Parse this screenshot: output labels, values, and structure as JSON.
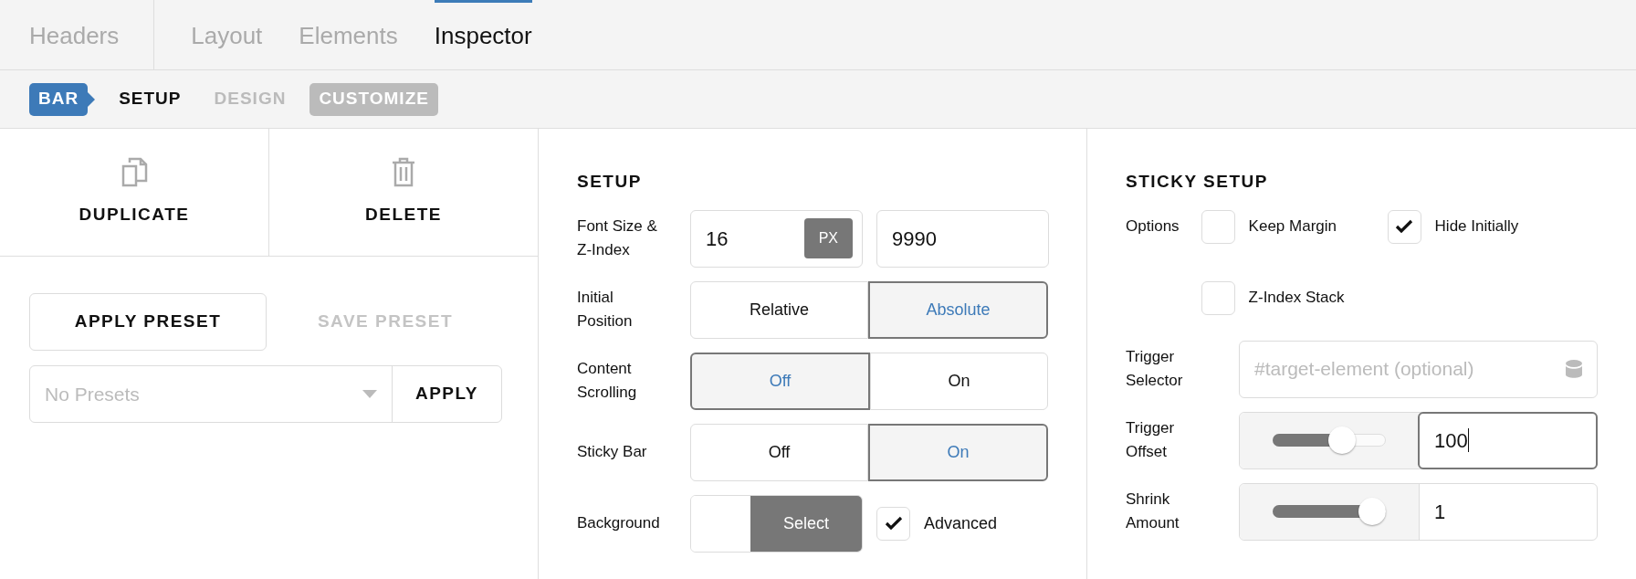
{
  "tabs": [
    {
      "label": "Headers",
      "selected": false
    },
    {
      "label": "Layout",
      "selected": false
    },
    {
      "label": "Elements",
      "selected": false
    },
    {
      "label": "Inspector",
      "selected": true
    }
  ],
  "breadcrumb": {
    "badge": "BAR",
    "steps": [
      {
        "label": "SETUP",
        "selected": true,
        "highlighted": false
      },
      {
        "label": "DESIGN",
        "selected": false,
        "highlighted": false
      },
      {
        "label": "CUSTOMIZE",
        "selected": false,
        "highlighted": true
      }
    ]
  },
  "actions": [
    {
      "label": "DUPLICATE",
      "kind": "copy"
    },
    {
      "label": "DELETE",
      "kind": "trash"
    }
  ],
  "presets": {
    "apply_preset": "APPLY PRESET",
    "save_preset": "SAVE PRESET",
    "save_disabled": true,
    "select_placeholder": "No Presets",
    "apply": "APPLY"
  },
  "setup": {
    "title": "SETUP",
    "rows": [
      {
        "kind": "inputs",
        "label": "Font Size & Z-Index",
        "value": "16",
        "unit": "PX",
        "value_2": "9990"
      },
      {
        "kind": "segmented",
        "label": "Initial Position",
        "options": [
          {
            "label": "Relative",
            "selected": false
          },
          {
            "label": "Absolute",
            "selected": true
          }
        ]
      },
      {
        "kind": "segmented",
        "label": "Content Scrolling",
        "options": [
          {
            "label": "Off",
            "selected": true
          },
          {
            "label": "On",
            "selected": false
          }
        ]
      },
      {
        "kind": "segmented",
        "label": "Sticky Bar",
        "options": [
          {
            "label": "Off",
            "selected": false
          },
          {
            "label": "On",
            "selected": true
          }
        ]
      },
      {
        "kind": "background",
        "label": "Background",
        "button": "Select",
        "checkbox": {
          "label": "Advanced",
          "checked": true
        }
      }
    ]
  },
  "sticky": {
    "title": "STICKY SETUP",
    "options_label": "Options",
    "options": [
      {
        "label": "Keep Margin",
        "checked": false
      },
      {
        "label": "Hide Initially",
        "checked": true
      },
      {
        "label": "Z-Index Stack",
        "checked": false
      }
    ],
    "trigger_selector": {
      "label": "Trigger Selector",
      "placeholder": "#target-element (optional)"
    },
    "sliders": [
      {
        "label": "Trigger Offset",
        "level": 0.65,
        "value": "100",
        "focused": true
      },
      {
        "label": "Shrink Amount",
        "level": 1,
        "value": "1",
        "focused": false
      }
    ]
  }
}
